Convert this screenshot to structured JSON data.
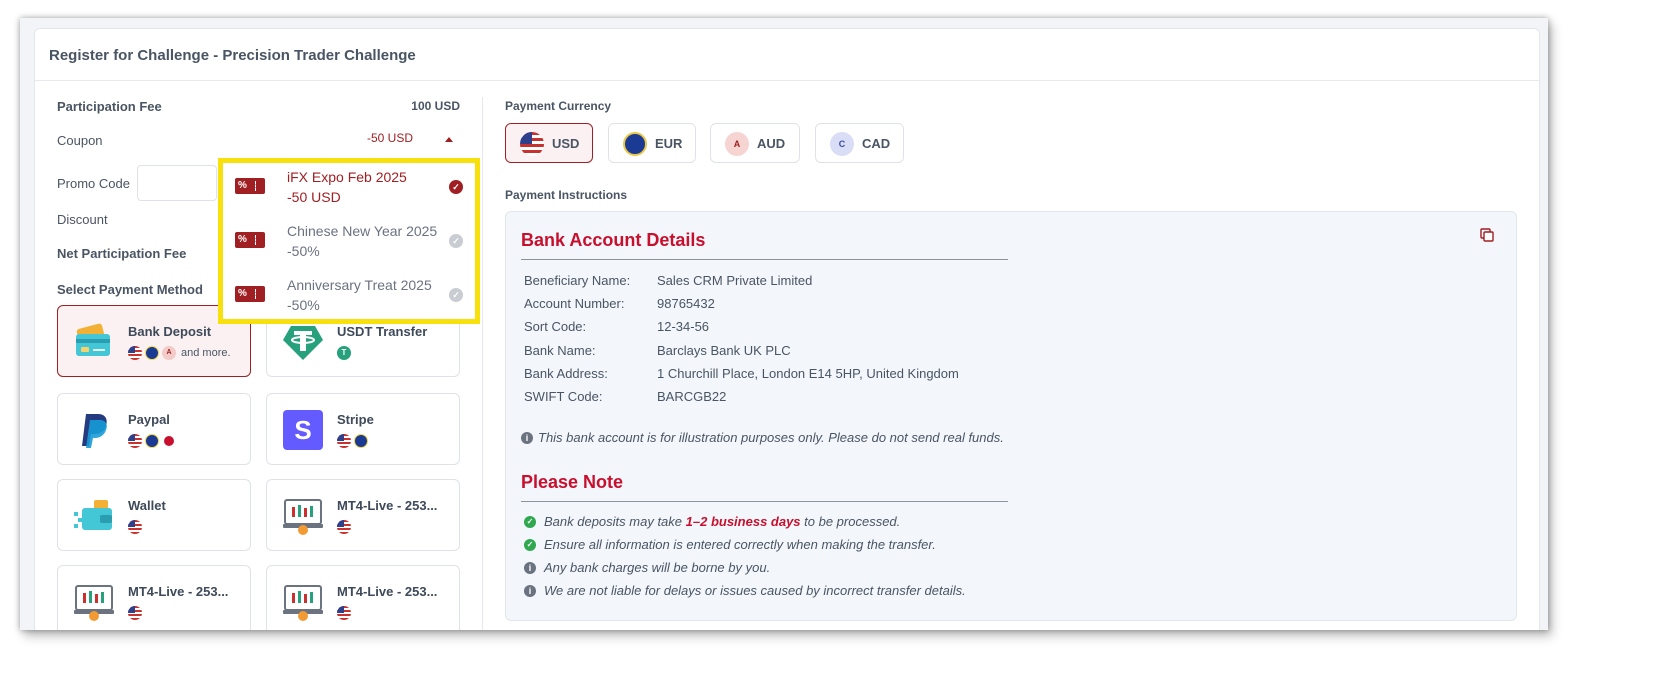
{
  "card": {
    "title": "Register for Challenge - Precision Trader Challenge"
  },
  "left": {
    "participation_fee_label": "Participation Fee",
    "participation_fee_value": "100 USD",
    "coupon_label": "Coupon",
    "coupon_value": "-50 USD",
    "promo_code_label": "Promo Code",
    "discount_label": "Discount",
    "net_fee_label": "Net Participation Fee",
    "select_payment_label": "Select Payment Method"
  },
  "coupons": [
    {
      "name": "iFX Expo Feb 2025",
      "amount": "-50 USD",
      "selected": true,
      "tag_icon": "coupon-tag-icon"
    },
    {
      "name": "Chinese New Year 2025",
      "amount": "-50%",
      "selected": false,
      "tag_icon": "coupon-tag-icon"
    },
    {
      "name": "Anniversary Treat 2025",
      "amount": "-50%",
      "selected": false,
      "tag_icon": "coupon-tag-icon"
    }
  ],
  "payment_methods": [
    {
      "name": "Bank Deposit",
      "icon": "bank-card-icon",
      "flags": [
        "us",
        "eu",
        "a"
      ],
      "more": "and more.",
      "selected": true
    },
    {
      "name": "USDT Transfer",
      "icon": "tether-icon",
      "flags": [
        "t"
      ],
      "more": "",
      "selected": false
    },
    {
      "name": "Paypal",
      "icon": "paypal-icon",
      "flags": [
        "us",
        "eu",
        "jp"
      ],
      "more": "",
      "selected": false
    },
    {
      "name": "Stripe",
      "icon": "stripe-icon",
      "flags": [
        "us",
        "eu"
      ],
      "more": "",
      "selected": false
    },
    {
      "name": "Wallet",
      "icon": "wallet-icon",
      "flags": [
        "us"
      ],
      "more": "",
      "selected": false
    },
    {
      "name": "MT4-Live - 253...",
      "icon": "mt4-terminal-icon",
      "flags": [
        "us"
      ],
      "more": "",
      "selected": false
    },
    {
      "name": "MT4-Live - 253...",
      "icon": "mt4-terminal-icon",
      "flags": [
        "us"
      ],
      "more": "",
      "selected": false
    },
    {
      "name": "MT4-Live - 253...",
      "icon": "mt4-terminal-icon",
      "flags": [
        "us"
      ],
      "more": "",
      "selected": false
    }
  ],
  "right": {
    "currency_label": "Payment Currency",
    "currencies": [
      {
        "code": "USD",
        "icon": "us",
        "selected": true
      },
      {
        "code": "EUR",
        "icon": "eu",
        "selected": false
      },
      {
        "code": "AUD",
        "icon": "A",
        "selected": false
      },
      {
        "code": "CAD",
        "icon": "C",
        "selected": false
      }
    ],
    "instructions_label": "Payment Instructions",
    "bank_title": "Bank Account Details",
    "details": [
      {
        "key": "Beneficiary Name:",
        "value": "Sales CRM Private Limited"
      },
      {
        "key": "Account Number:",
        "value": "98765432"
      },
      {
        "key": "Sort Code:",
        "value": "12-34-56"
      },
      {
        "key": "Bank Name:",
        "value": "Barclays Bank UK PLC"
      },
      {
        "key": "Bank Address:",
        "value": "1 Churchill Place, London E14 5HP, United Kingdom"
      },
      {
        "key": "SWIFT Code:",
        "value": "BARCGB22"
      }
    ],
    "illustration_note": "This bank account is for illustration purposes only. Please do not send real funds.",
    "note_title": "Please Note",
    "notes": [
      {
        "type": "ok",
        "pre": "Bank deposits may take ",
        "highlight": "1–2 business days",
        "post": " to be processed."
      },
      {
        "type": "ok",
        "pre": "Ensure all information is entered correctly when making the transfer.",
        "highlight": "",
        "post": ""
      },
      {
        "type": "info",
        "pre": "Any bank charges will be borne by you.",
        "highlight": "",
        "post": ""
      },
      {
        "type": "info",
        "pre": "We are not liable for delays or issues caused by incorrect transfer details.",
        "highlight": "",
        "post": ""
      }
    ]
  },
  "colors": {
    "accent": "#a01f23",
    "highlight_border": "#f7e00b",
    "heading_red": "#c8102e"
  }
}
